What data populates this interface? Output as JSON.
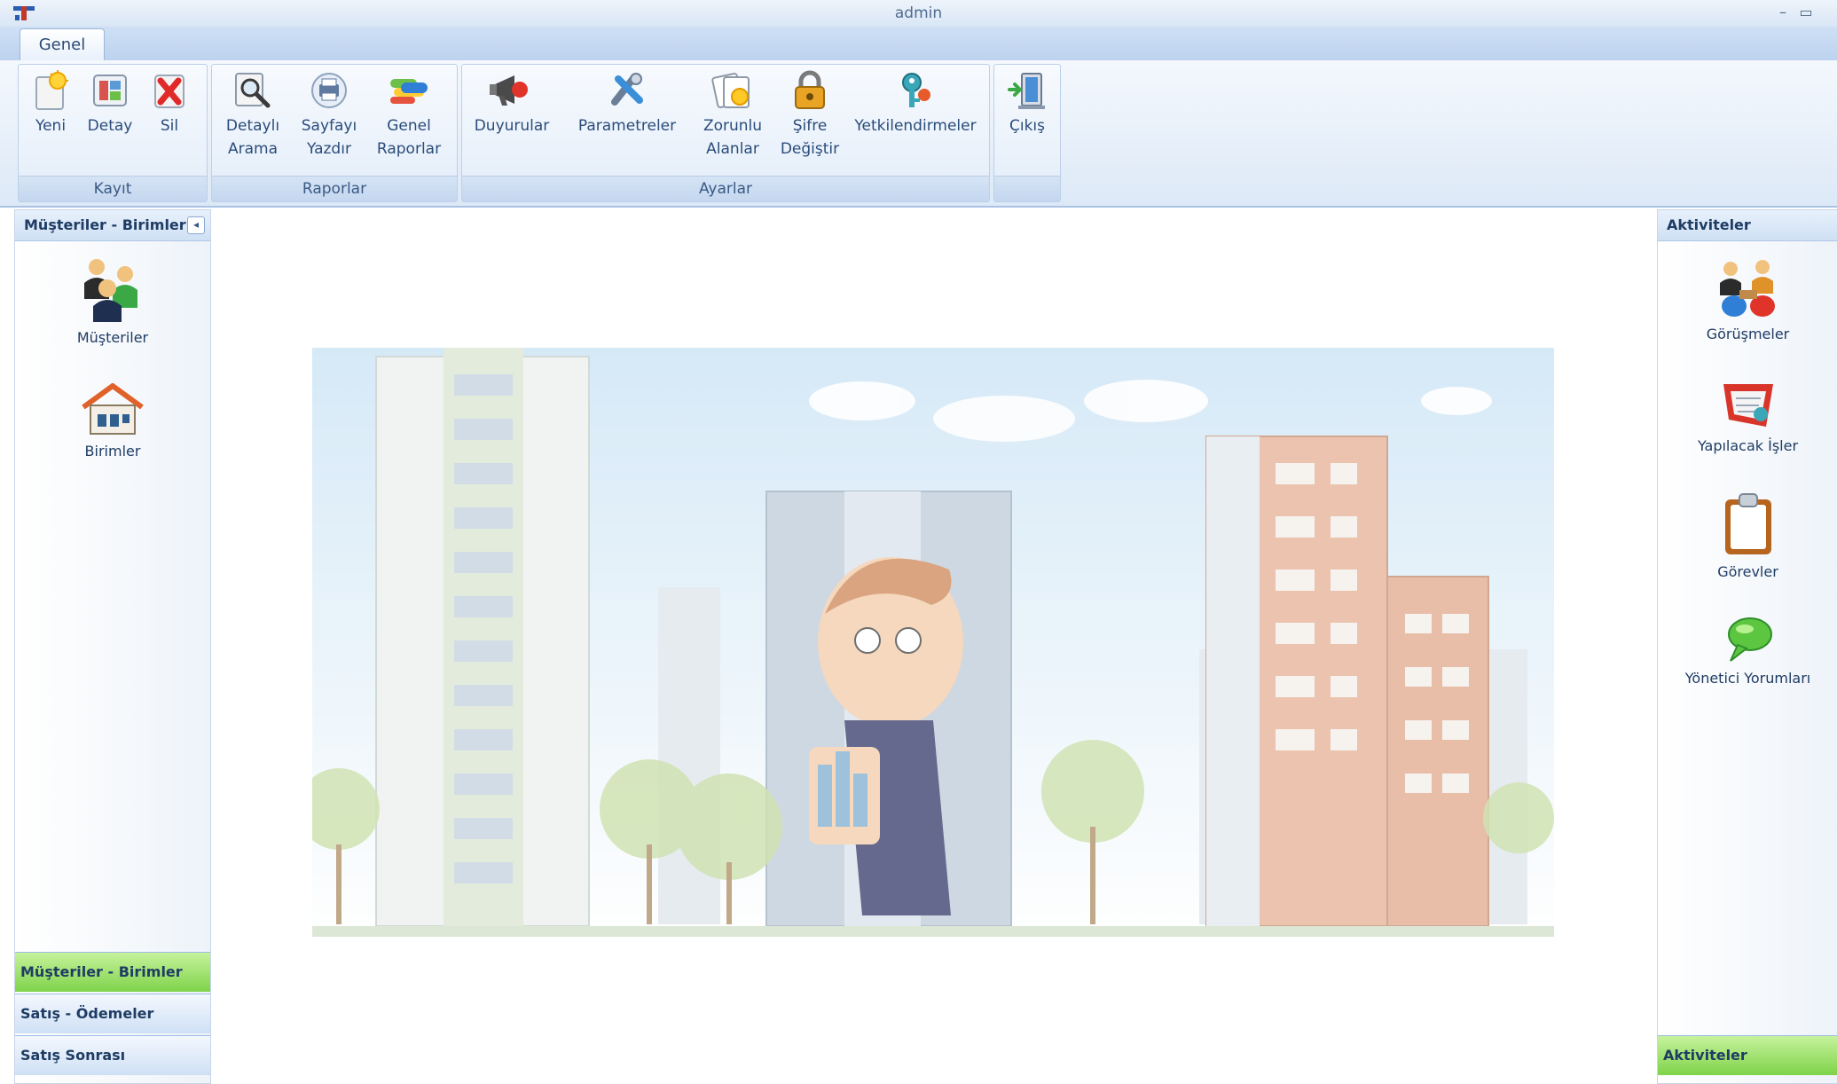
{
  "window": {
    "title": "admin",
    "minimize_icon": "minimize-icon",
    "maximize_icon": "maximize-icon"
  },
  "tabs": [
    {
      "label": "Genel",
      "active": true
    }
  ],
  "ribbon": {
    "groups": [
      {
        "label": "Kayıt",
        "buttons": [
          {
            "label": "Yeni",
            "icon": "new-icon"
          },
          {
            "label": "Detay",
            "icon": "detail-icon"
          },
          {
            "label": "Sil",
            "icon": "delete-icon"
          }
        ]
      },
      {
        "label": "Raporlar",
        "buttons": [
          {
            "label_line1": "Detaylı",
            "label_line2": "Arama",
            "icon": "search-icon"
          },
          {
            "label_line1": "Sayfayı",
            "label_line2": "Yazdır",
            "icon": "print-icon"
          },
          {
            "label_line1": "Genel",
            "label_line2": "Raporlar",
            "icon": "reports-icon"
          }
        ]
      },
      {
        "label": "Ayarlar",
        "buttons": [
          {
            "label": "Duyurular",
            "icon": "megaphone-icon"
          },
          {
            "label": "Parametreler",
            "icon": "tools-icon"
          },
          {
            "label_line1": "Zorunlu",
            "label_line2": "Alanlar",
            "icon": "required-fields-icon"
          },
          {
            "label_line1": "Şifre",
            "label_line2": "Değiştir",
            "icon": "lock-icon"
          },
          {
            "label": "Yetkilendirmeler",
            "icon": "key-icon"
          }
        ]
      },
      {
        "label": "",
        "buttons": [
          {
            "label": "Çıkış",
            "icon": "exit-icon"
          }
        ]
      }
    ]
  },
  "left_panel": {
    "header": "Müşteriler - Birimler",
    "collapse_icon": "chevron-left-icon",
    "items": [
      {
        "label": "Müşteriler",
        "icon": "customers-icon"
      },
      {
        "label": "Birimler",
        "icon": "house-icon"
      }
    ],
    "nav": [
      {
        "label": "Müşteriler - Birimler",
        "active": true
      },
      {
        "label": "Satış - Ödemeler",
        "active": false
      },
      {
        "label": "Satış Sonrası",
        "active": false
      }
    ]
  },
  "right_panel": {
    "header": "Aktiviteler",
    "items": [
      {
        "label": "Görüşmeler",
        "icon": "meetings-icon"
      },
      {
        "label": "Yapılacak İşler",
        "icon": "todo-icon"
      },
      {
        "label": "Görevler",
        "icon": "clipboard-icon"
      },
      {
        "label": "Yönetici Yorumları",
        "icon": "comment-bubble-icon"
      }
    ],
    "nav": [
      {
        "label": "Aktiviteler",
        "active": true
      }
    ]
  },
  "colors": {
    "accent_green": "#7fd34a",
    "ribbon_blue": "#dde9f7",
    "panel_border": "#c7d6e9"
  }
}
